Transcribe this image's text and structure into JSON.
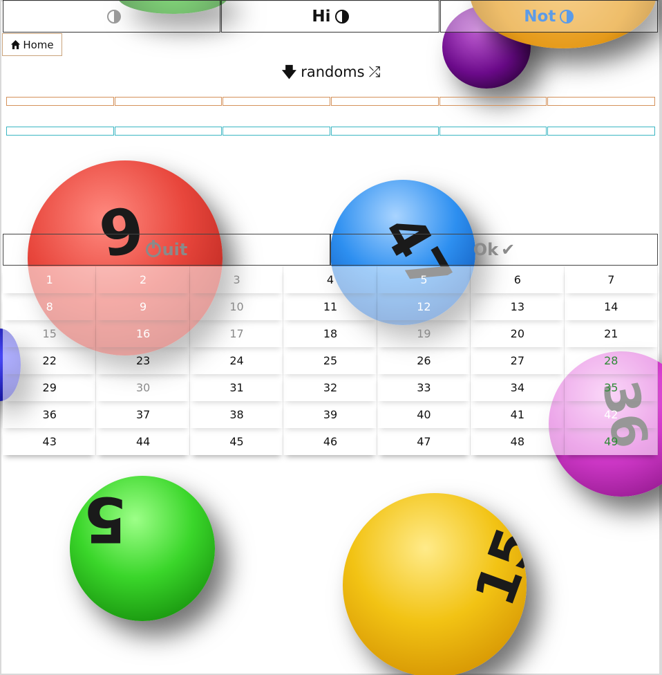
{
  "tabs": [
    {
      "label": "",
      "icon": "contrast-icon"
    },
    {
      "label": "Hi",
      "icon": "contrast-icon"
    },
    {
      "label": "Not",
      "icon": "contrast-icon",
      "color": "#5b9be8"
    }
  ],
  "home": {
    "label": "Home",
    "icon": "home-icon"
  },
  "randoms": {
    "label": "randoms",
    "icons": [
      "arrow-down-icon",
      "shuffle-icon"
    ]
  },
  "actions": {
    "quit_label": "uit",
    "ok_label": "Ok"
  },
  "numbers": [
    {
      "n": "1",
      "tone": "light"
    },
    {
      "n": "2",
      "tone": "light"
    },
    {
      "n": "3",
      "tone": "grey"
    },
    {
      "n": "4",
      "tone": "dark"
    },
    {
      "n": "5",
      "tone": "light"
    },
    {
      "n": "6",
      "tone": "dark"
    },
    {
      "n": "7",
      "tone": "dark"
    },
    {
      "n": "8",
      "tone": "light"
    },
    {
      "n": "9",
      "tone": "light"
    },
    {
      "n": "10",
      "tone": "grey"
    },
    {
      "n": "11",
      "tone": "dark"
    },
    {
      "n": "12",
      "tone": "light"
    },
    {
      "n": "13",
      "tone": "dark"
    },
    {
      "n": "14",
      "tone": "dark"
    },
    {
      "n": "15",
      "tone": "grey"
    },
    {
      "n": "16",
      "tone": "light"
    },
    {
      "n": "17",
      "tone": "grey"
    },
    {
      "n": "18",
      "tone": "dark"
    },
    {
      "n": "19",
      "tone": "grey"
    },
    {
      "n": "20",
      "tone": "dark"
    },
    {
      "n": "21",
      "tone": "dark"
    },
    {
      "n": "22",
      "tone": "dark"
    },
    {
      "n": "23",
      "tone": "dark"
    },
    {
      "n": "24",
      "tone": "dark"
    },
    {
      "n": "25",
      "tone": "dark"
    },
    {
      "n": "26",
      "tone": "dark"
    },
    {
      "n": "27",
      "tone": "dark"
    },
    {
      "n": "28",
      "tone": "green"
    },
    {
      "n": "29",
      "tone": "dark"
    },
    {
      "n": "30",
      "tone": "grey"
    },
    {
      "n": "31",
      "tone": "dark"
    },
    {
      "n": "32",
      "tone": "dark"
    },
    {
      "n": "33",
      "tone": "dark"
    },
    {
      "n": "34",
      "tone": "dark"
    },
    {
      "n": "35",
      "tone": "green"
    },
    {
      "n": "36",
      "tone": "dark"
    },
    {
      "n": "37",
      "tone": "dark"
    },
    {
      "n": "38",
      "tone": "dark"
    },
    {
      "n": "39",
      "tone": "dark"
    },
    {
      "n": "40",
      "tone": "dark"
    },
    {
      "n": "41",
      "tone": "dark"
    },
    {
      "n": "42",
      "tone": "light"
    },
    {
      "n": "43",
      "tone": "dark"
    },
    {
      "n": "44",
      "tone": "dark"
    },
    {
      "n": "45",
      "tone": "dark"
    },
    {
      "n": "46",
      "tone": "dark"
    },
    {
      "n": "47",
      "tone": "dark"
    },
    {
      "n": "48",
      "tone": "dark"
    },
    {
      "n": "49",
      "tone": "green"
    }
  ],
  "balls": [
    {
      "label": "9",
      "color": "#e8463c",
      "icon": "red-ball"
    },
    {
      "label": "47",
      "color": "#2d8ff0",
      "icon": "blue-ball"
    },
    {
      "label": "36",
      "color": "#d63ccf",
      "icon": "magenta-ball"
    },
    {
      "label": "15",
      "color": "#f2c314",
      "icon": "yellow-ball"
    },
    {
      "label": "5",
      "color": "#3ad62a",
      "icon": "green-ball"
    }
  ]
}
